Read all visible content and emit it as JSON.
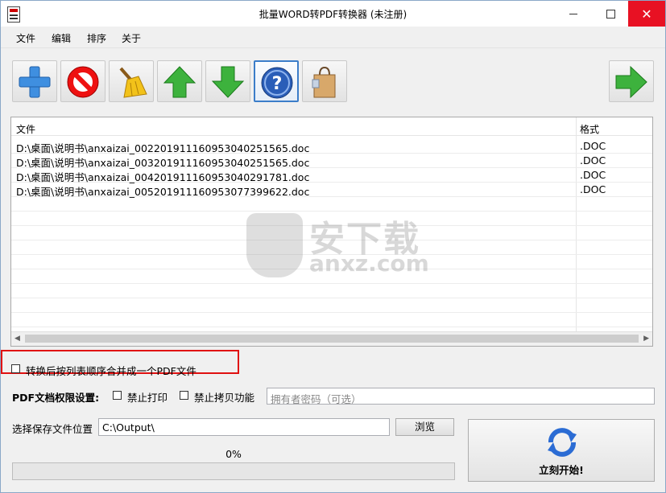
{
  "window": {
    "title": "批量WORD转PDF转换器 (未注册)",
    "controls": {
      "minimize_icon": "minimize-icon",
      "maximize_icon": "maximize-icon",
      "close_icon": "close-icon"
    }
  },
  "menu": [
    {
      "label": "文件"
    },
    {
      "label": "编辑"
    },
    {
      "label": "排序"
    },
    {
      "label": "关于"
    }
  ],
  "toolbar": [
    {
      "icon": "add-icon"
    },
    {
      "icon": "remove-icon"
    },
    {
      "icon": "clear-broom-icon"
    },
    {
      "icon": "move-up-icon"
    },
    {
      "icon": "move-down-icon"
    },
    {
      "icon": "help-icon",
      "selected": true
    },
    {
      "icon": "shopping-bag-icon"
    },
    {
      "icon": "next-arrow-icon"
    }
  ],
  "file_list": {
    "columns": [
      "文件",
      "格式"
    ],
    "rows": [
      {
        "path": "D:\\桌面\\说明书\\anxaizai_0022019111609530402515​65.doc",
        "format": ".DOC"
      },
      {
        "path": "D:\\桌面\\说明书\\anxaizai_00320191116095304025156​5.doc",
        "format": ".DOC"
      },
      {
        "path": "D:\\桌面\\说明书\\anxaizai_00420191116095304029178​1.doc",
        "format": ".DOC"
      },
      {
        "path": "D:\\桌面\\说明书\\anxaizai_00520191116095307739962​2.doc",
        "format": ".DOC"
      }
    ]
  },
  "watermark": {
    "line1": "安下载",
    "line2": "anxz.com"
  },
  "merge_option": {
    "label": "转换后按列表顺序合并成一个PDF文件",
    "checked": false
  },
  "permissions": {
    "label": "PDF文档权限设置:",
    "no_print": {
      "label": "禁止打印",
      "checked": false
    },
    "no_copy": {
      "label": "禁止拷贝功能",
      "checked": false
    },
    "owner_password_placeholder": "拥有者密码（可选）"
  },
  "output": {
    "label": "选择保存文件位置",
    "path": "C:\\Output\\",
    "browse_label": "浏览"
  },
  "progress": {
    "text": "0%",
    "value": 0
  },
  "start_button": {
    "label": "立刻开始!"
  }
}
